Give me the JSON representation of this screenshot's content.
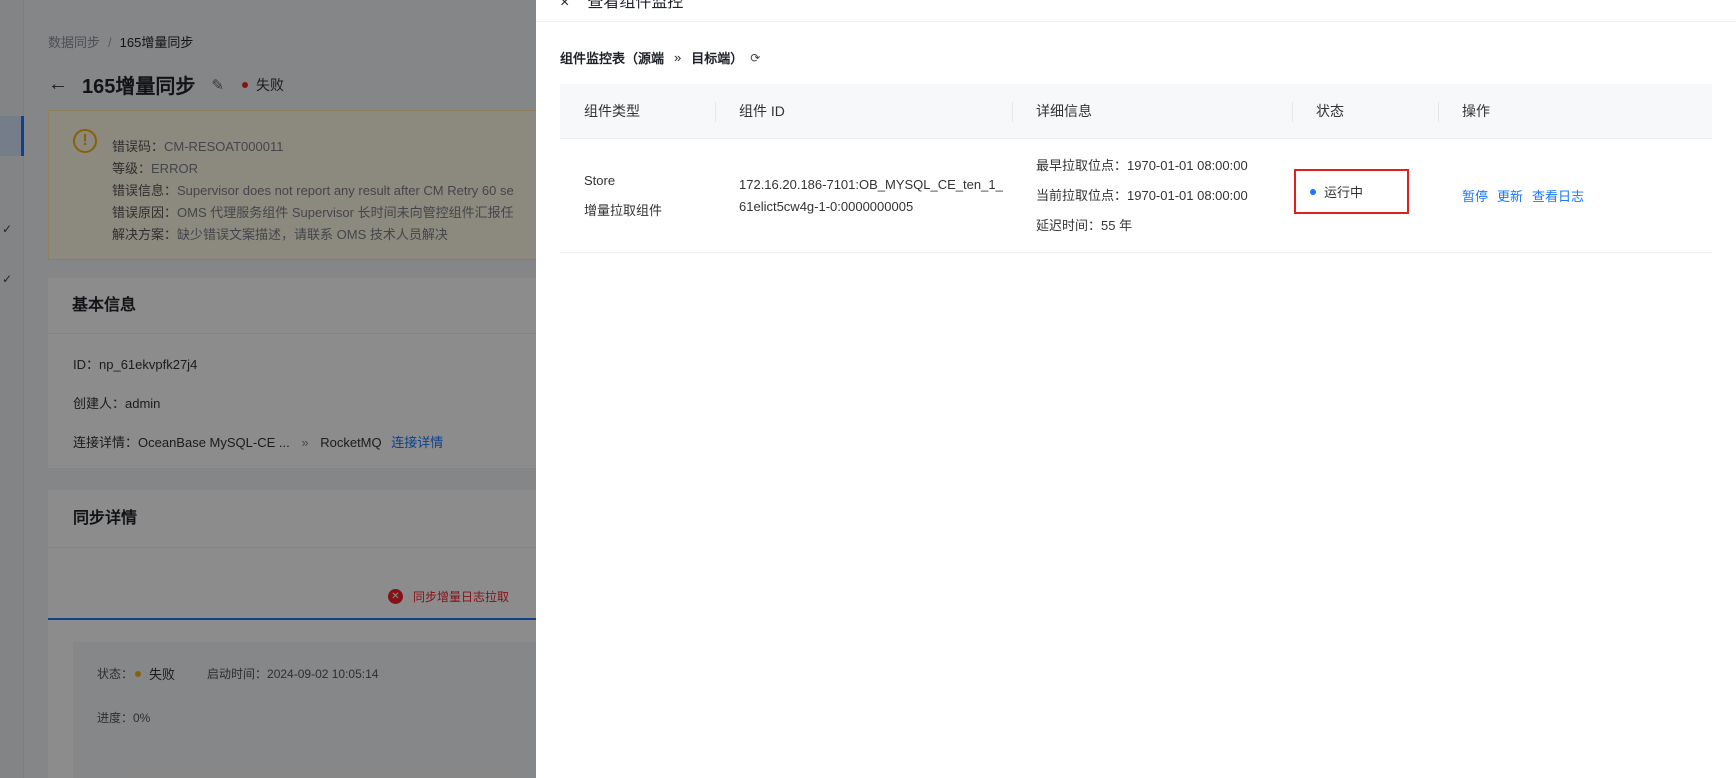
{
  "background": {
    "breadcrumb": {
      "root": "数据同步",
      "separator": "/",
      "current": "165增量同步"
    },
    "page_title": "165增量同步",
    "status_text": "失败",
    "alert": {
      "code_label": "错误码：",
      "code_value": "CM-RESOAT000011",
      "level_label": "等级：",
      "level_value": "ERROR",
      "info_label": "错误信息：",
      "info_value": "Supervisor does not report any result after CM Retry 60 se",
      "reason_label": "错误原因：",
      "reason_value": "OMS 代理服务组件 Supervisor 长时间未向管控组件汇报任",
      "solution_label": "解决方案：",
      "solution_value": "缺少错误文案描述，请联系 OMS 技术人员解决"
    },
    "basic_info": {
      "title": "基本信息",
      "id_line": "ID：np_61ekvpfk27j4",
      "creator_line": "创建人：admin",
      "conn_label": "连接详情：OceanBase MySQL-CE ...",
      "conn_arrow": "»",
      "conn_target": "RocketMQ",
      "conn_link": "连接详情"
    },
    "sync_details": {
      "title": "同步详情",
      "step_label": "同步增量日志拉取",
      "status_label": "状态：",
      "status_value": "失败",
      "start_time": "启动时间：2024-09-02 10:05:14",
      "progress": "进度：0%"
    }
  },
  "drawer": {
    "title": "查看组件监控",
    "close_icon": "×",
    "section_source": "组件监控表（源端",
    "section_arrow": "»",
    "section_target": "目标端）",
    "columns": [
      "组件类型",
      "组件 ID",
      "详细信息",
      "状态",
      "操作"
    ],
    "rows": [
      {
        "type_line1": "Store",
        "type_line2": "增量拉取组件",
        "id_line1": "172.16.20.186-7101:OB_MYSQL_CE_ten_1_",
        "id_line2": "61elict5cw4g-1-0:0000000005",
        "detail_earliest": "最早拉取位点：1970-01-01 08:00:00",
        "detail_current": "当前拉取位点：1970-01-01 08:00:00",
        "detail_delay": "延迟时间：55 年",
        "status": "运行中",
        "status_color": "#1677ff",
        "actions": [
          "暂停",
          "更新",
          "查看日志"
        ]
      }
    ]
  },
  "colors": {
    "accent": "#1677ff",
    "error": "#f5222d",
    "warning": "#faad14",
    "highlight_border": "#e02020"
  }
}
